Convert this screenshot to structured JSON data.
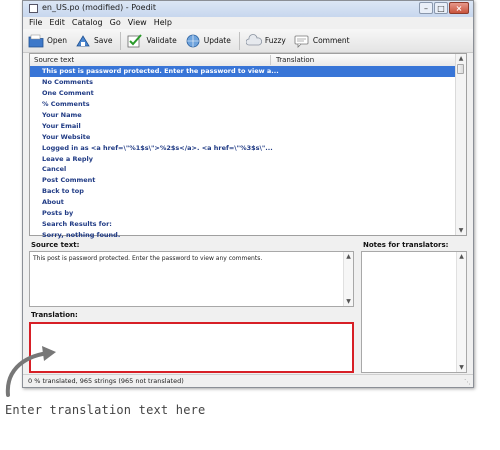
{
  "window": {
    "title": "en_US.po (modified) - Poedit"
  },
  "menu": [
    "File",
    "Edit",
    "Catalog",
    "Go",
    "View",
    "Help"
  ],
  "toolbar": {
    "open": "Open",
    "save": "Save",
    "validate": "Validate",
    "update": "Update",
    "fuzzy": "Fuzzy",
    "comment": "Comment"
  },
  "list": {
    "col_source": "Source text",
    "col_translation": "Translation",
    "rows": [
      "This post is password protected. Enter the password to view a...",
      "No Comments",
      "One Comment",
      "% Comments",
      "Your Name",
      "Your Email",
      "Your Website",
      "Logged in as <a href=\\\"%1$s\\\">%2$s</a>. <a href=\\\"%3$s\\\"...",
      "Leave a Reply",
      "Cancel",
      "Post Comment",
      "Back to top",
      "About",
      "Posts by",
      "Search Results for:",
      "Sorry, nothing found."
    ]
  },
  "panes": {
    "source_label": "Source text:",
    "source_text": "This post is password protected. Enter the password to view any comments.",
    "notes_label": "Notes for translators:",
    "translation_label": "Translation:",
    "translation_value": ""
  },
  "status": {
    "text": "0 % translated, 965 strings (965 not translated)"
  },
  "annotation": {
    "text": "Enter translation text here"
  },
  "colors": {
    "selection": "#3875d7",
    "entry_text": "#1f3a84",
    "highlight_border": "#d71f26"
  }
}
